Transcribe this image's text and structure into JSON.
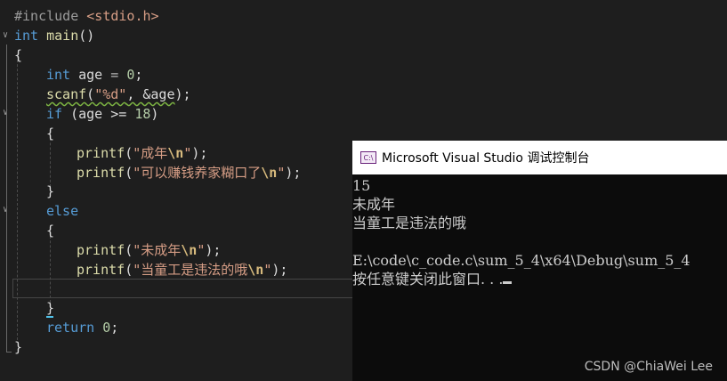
{
  "editor": {
    "lines": {
      "l1": {
        "directive": "#include",
        "header": "<stdio.h>"
      },
      "l2": {
        "kw": "int",
        "name": "main",
        "rest": "()"
      },
      "l3": "{",
      "l5": {
        "kw": "int",
        "name": "age",
        "op": " = ",
        "num": "0",
        "end": ";"
      },
      "l6": {
        "fn": "scanf",
        "open": "(",
        "str": "\"%d\"",
        "mid": ", &age",
        "close": ");"
      },
      "l7": {
        "kw": "if",
        "rest": " (age >= ",
        "num": "18",
        "close": ")"
      },
      "l8": "{",
      "l9": {
        "fn": "printf",
        "open": "(",
        "str": "\"成年",
        "esc": "\\n",
        "strend": "\"",
        "close": ");"
      },
      "l10": {
        "fn": "printf",
        "open": "(",
        "str": "\"可以赚钱养家糊口了",
        "esc": "\\n",
        "strend": "\"",
        "close": ");"
      },
      "l11": "}",
      "l12": {
        "kw": "else"
      },
      "l13": "{",
      "l14": {
        "fn": "printf",
        "open": "(",
        "str": "\"未成年",
        "esc": "\\n",
        "strend": "\"",
        "close": ");"
      },
      "l15": {
        "fn": "printf",
        "open": "(",
        "str": "\"当童工是违法的哦",
        "esc": "\\n",
        "strend": "\"",
        "close": ");"
      },
      "l17": "}",
      "l18": {
        "kw": "return",
        "num": "0",
        "end": ";"
      },
      "l19": "}"
    }
  },
  "console": {
    "title": "Microsoft Visual Studio 调试控制台",
    "icon": "vs-console-icon",
    "output": [
      "15",
      "未成年",
      "当童工是违法的哦",
      "",
      "E:\\code\\c_code.c\\sum_5_4\\x64\\Debug\\sum_5_4",
      "按任意键关闭此窗口. . ."
    ]
  },
  "watermark": "CSDN @ChiaWei Lee",
  "colors": {
    "background": "#1e1e1e",
    "keyword": "#569cd6",
    "function": "#dcdcaa",
    "string": "#d69d85",
    "number": "#b5cea8",
    "console_bg": "#0c0c0c"
  }
}
